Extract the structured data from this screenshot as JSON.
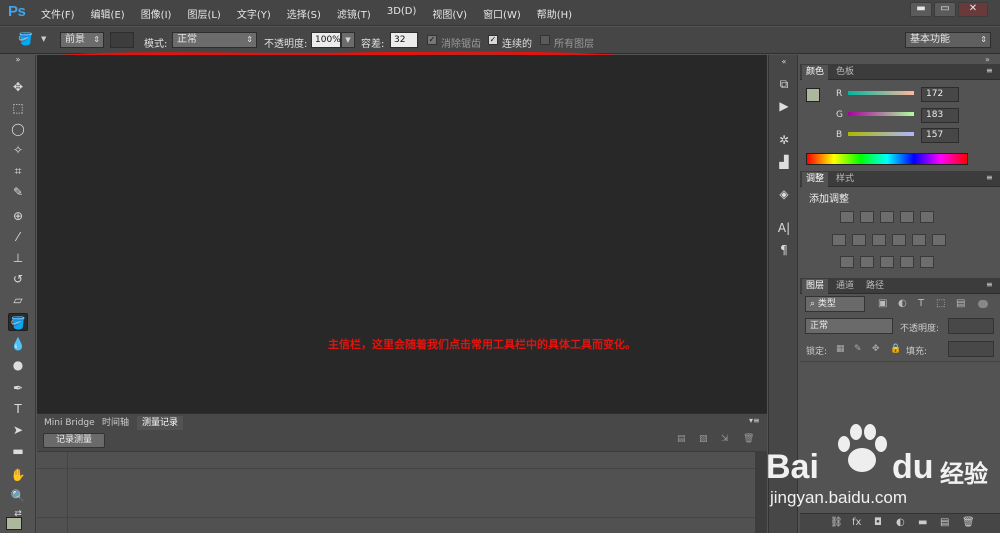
{
  "app": {
    "logo": "Ps"
  },
  "menu": [
    "文件(F)",
    "编辑(E)",
    "图像(I)",
    "图层(L)",
    "文字(Y)",
    "选择(S)",
    "滤镜(T)",
    "3D(D)",
    "视图(V)",
    "窗口(W)",
    "帮助(H)"
  ],
  "window_controls": {
    "minimize": "▬",
    "restore": "▭",
    "close": "✕"
  },
  "options": {
    "fill_source": "前景",
    "mode_label": "模式:",
    "mode_value": "正常",
    "opacity_label": "不透明度:",
    "opacity_value": "100%",
    "tolerance_label": "容差:",
    "tolerance_value": "32",
    "antialias_label": "消除锯齿",
    "antialias_checked": true,
    "contiguous_label": "连续的",
    "contiguous_checked": true,
    "all_layers_label": "所有图层",
    "all_layers_checked": false,
    "workspace": "基本功能"
  },
  "toolbar": {
    "tools": [
      "move-icon",
      "marquee-icon",
      "lasso-icon",
      "magic-wand-icon",
      "crop-icon",
      "eyedropper-icon",
      "healing-icon",
      "brush-icon",
      "stamp-icon",
      "history-brush-icon",
      "eraser-icon",
      "paint-bucket-icon",
      "blur-icon",
      "dodge-icon",
      "pen-icon",
      "type-icon",
      "path-select-icon",
      "shape-icon",
      "hand-icon",
      "zoom-icon"
    ],
    "active_tool": "paint-bucket-icon",
    "foreground_color": "#acb79d"
  },
  "bottom_panel": {
    "tabs": [
      "Mini Bridge",
      "时间轴",
      "测量记录"
    ],
    "active_tab": "测量记录",
    "record_button": "记录测量"
  },
  "color_panel": {
    "tabs": [
      "颜色",
      "色板"
    ],
    "r_label": "R",
    "r_value": "172",
    "g_label": "G",
    "g_value": "183",
    "b_label": "B",
    "b_value": "157"
  },
  "adjust_panel": {
    "tabs": [
      "调整",
      "样式"
    ],
    "title": "添加调整"
  },
  "layers_panel": {
    "tabs": [
      "图层",
      "通道",
      "路径"
    ],
    "filter_label": "类型",
    "blend_mode": "正常",
    "opacity_label": "不透明度:",
    "lock_label": "锁定:",
    "fill_label": "填充:"
  },
  "annotation": {
    "text": "主信栏，这里会随着我们点击常用工具栏中的具体工具而变化。",
    "color": "#e3140e"
  },
  "watermark": {
    "brand": "Bai",
    "brand2": "du",
    "cn": "经验",
    "url": "jingyan.baidu.com"
  }
}
